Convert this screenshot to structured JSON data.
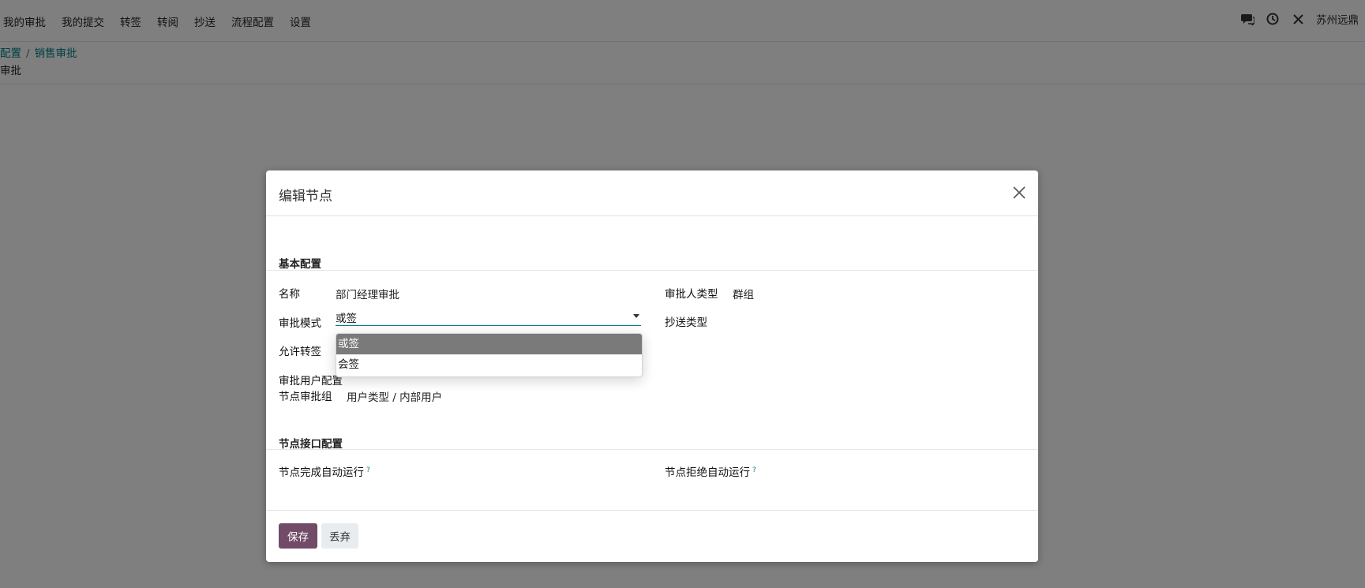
{
  "topbar": {
    "menu": [
      "我的审批",
      "我的提交",
      "转签",
      "转阅",
      "抄送",
      "流程配置",
      "设置"
    ],
    "company": "苏州远鼎",
    "icons": [
      "chat-icon",
      "clock-icon",
      "tools-icon"
    ]
  },
  "breadcrumb": {
    "parent": "配置",
    "current": "销售审批",
    "subtitle": "审批"
  },
  "modal": {
    "title": "编辑节点",
    "sections": {
      "basic": "基本配置",
      "interface": "节点接口配置"
    },
    "fields": {
      "name_label": "名称",
      "name_value": "部门经理审批",
      "approver_type_label": "审批人类型",
      "approver_type_value": "群组",
      "mode_label": "审批模式",
      "mode_value": "或签",
      "cc_type_label": "抄送类型",
      "allow_transfer_label": "允许转签",
      "user_config_label": "审批用户配置",
      "group_label": "节点审批组",
      "group_value": "用户类型 / 内部用户",
      "auto_complete_label": "节点完成自动运行",
      "auto_reject_label": "节点拒绝自动运行",
      "help_mark": "?"
    },
    "dropdown": {
      "options": [
        "或签",
        "会签"
      ],
      "selected_index": 0
    },
    "buttons": {
      "save": "保存",
      "discard": "丢弃"
    }
  },
  "colors": {
    "primary": "#714b67",
    "link": "#017e84",
    "overlay": "rgba(0,0,0,0.5)"
  }
}
